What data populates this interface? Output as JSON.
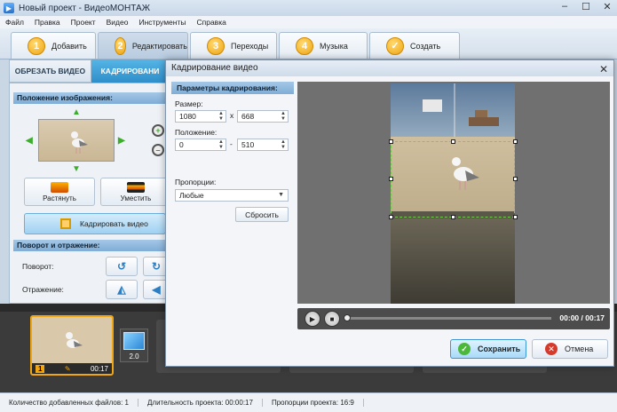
{
  "window": {
    "title": "Новый проект - ВидеоМОНТАЖ"
  },
  "menu": [
    "Файл",
    "Правка",
    "Проект",
    "Видео",
    "Инструменты",
    "Справка"
  ],
  "steps": [
    {
      "num": "1",
      "label": "Добавить"
    },
    {
      "num": "2",
      "label": "Редактировать"
    },
    {
      "num": "3",
      "label": "Переходы"
    },
    {
      "num": "4",
      "label": "Музыка"
    },
    {
      "num": "✓",
      "label": "Создать"
    }
  ],
  "subtabs": {
    "trim": "ОБРЕЗАТЬ ВИДЕО",
    "crop": "КАДРИРОВАНИ"
  },
  "left": {
    "position_header": "Положение изображения:",
    "stretch": "Растянуть",
    "fit": "Уместить",
    "crop_video": "Кадрировать видео",
    "rotate_header": "Поворот и отражение:",
    "rotate_label": "Поворот:",
    "mirror_label": "Отражение:"
  },
  "timeline": {
    "clip_num": "1",
    "clip_time": "00:17",
    "transition": "2.0"
  },
  "status": {
    "files": "Количество добавленных файлов: 1",
    "duration": "Длительность проекта: 00:00:17",
    "ratio": "Пропорции проекта: 16:9"
  },
  "dialog": {
    "title": "Кадрирование видео",
    "params_header": "Параметры кадрирования:",
    "size_label": "Размер:",
    "width": "1080",
    "times": "x",
    "height": "668",
    "position_label": "Положение:",
    "pos_x": "0",
    "dash": "-",
    "pos_y": "510",
    "ratio_label": "Пропорции:",
    "ratio_value": "Любые",
    "reset": "Сбросить",
    "time": "00:00 / 00:17",
    "save": "Сохранить",
    "cancel": "Отмена"
  },
  "colors": {
    "accent": "#2f8ec9",
    "step_badge": "#f0a512",
    "crop_border": "#6fd04a"
  }
}
